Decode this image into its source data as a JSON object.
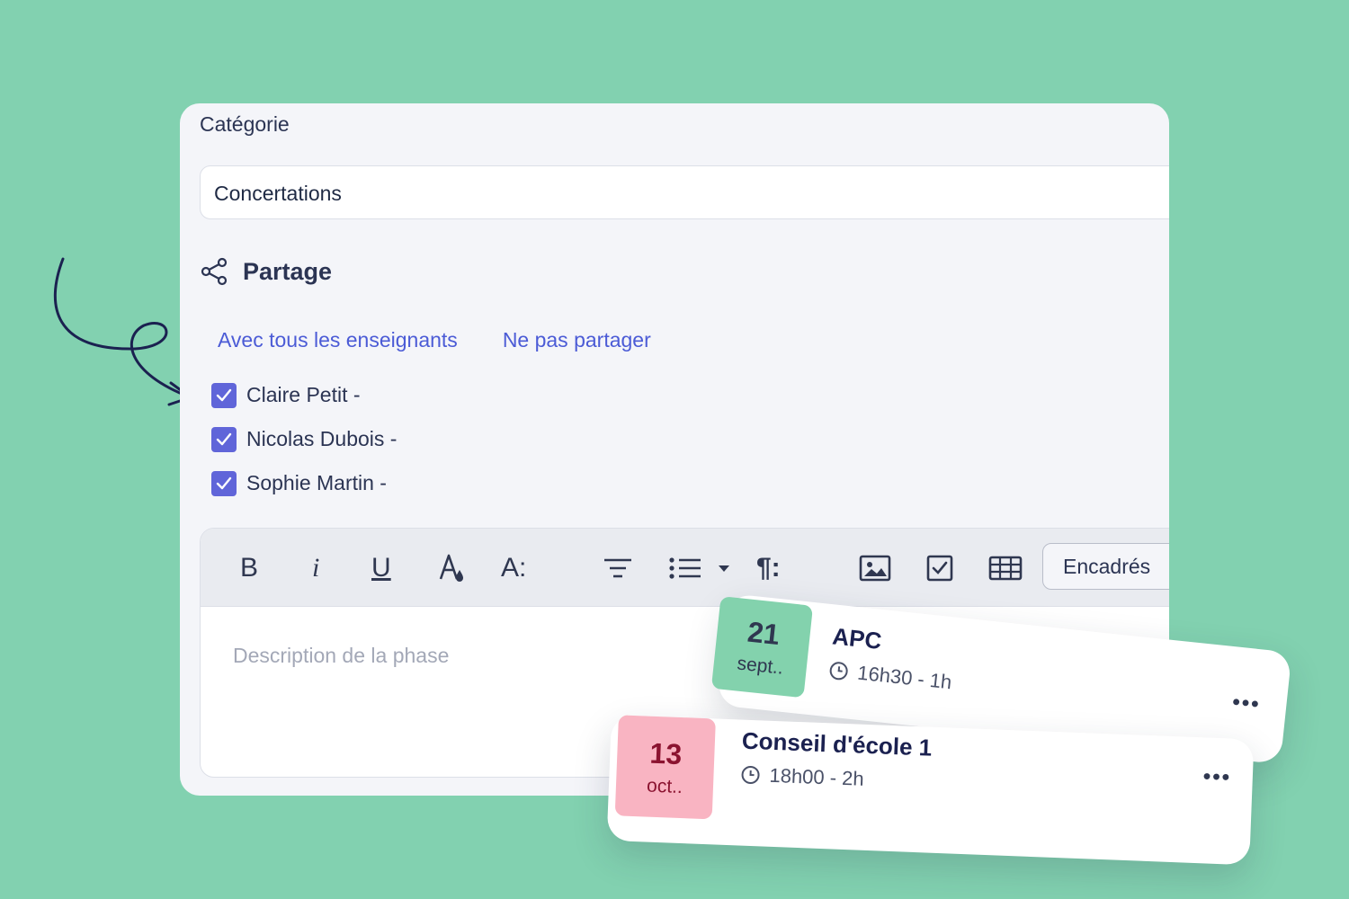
{
  "form": {
    "category_label": "Catégorie",
    "category_value": "Concertations",
    "share_title": "Partage",
    "share_options": [
      "Avec tous les enseignants",
      "Ne pas partager"
    ],
    "teachers": [
      {
        "name": "Claire Petit -",
        "checked": true
      },
      {
        "name": "Nicolas Dubois -",
        "checked": true
      },
      {
        "name": "Sophie Martin -",
        "checked": true
      }
    ]
  },
  "editor": {
    "toolbar": {
      "bold": "B",
      "italic": "i",
      "underline": "U",
      "font_size": "A:",
      "paragraph": "¶:",
      "encadres": "Encadrés"
    },
    "placeholder": "Description de la phase"
  },
  "events": [
    {
      "day": "21",
      "month": "sept..",
      "title": "APC",
      "time": "16h30 - 1h",
      "color": "#83d2ad"
    },
    {
      "day": "13",
      "month": "oct..",
      "title": "Conseil d'école 1",
      "time": "18h00 - 2h",
      "color": "#f9b4c2"
    }
  ],
  "colors": {
    "background": "#82d1b0",
    "accent": "#6065d9",
    "link": "#4b5bd6"
  }
}
